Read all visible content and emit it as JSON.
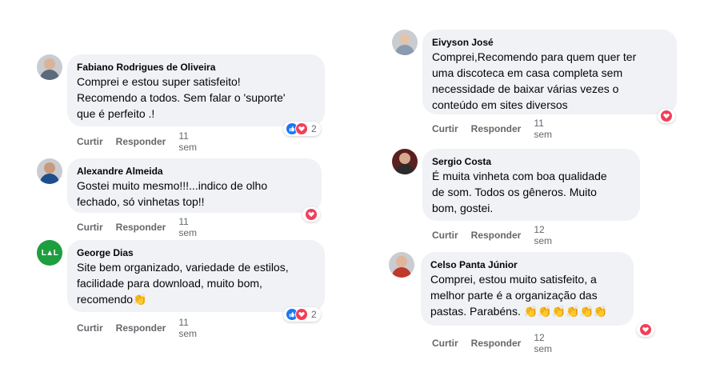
{
  "actions": {
    "like": "Curtir",
    "reply": "Responder"
  },
  "comments": [
    {
      "author": "Fabiano Rodrigues de Oliveira",
      "text": "Comprei e estou super satisfeito!\nRecomendo a todos. Sem falar o 'suporte'\nque é perfeito .!",
      "time": "11 sem",
      "reaction_count": "2"
    },
    {
      "author": "Alexandre Almeida",
      "text": "Gostei muito mesmo!!!...indico de olho\nfechado, só vinhetas top!!",
      "time": "11 sem"
    },
    {
      "author": "George Dias",
      "text": "Site bem organizado, variedade de estilos,\nfacilidade para download, muito bom,\nrecomendo",
      "time": "11 sem",
      "reaction_count": "2",
      "emoji": "👏"
    },
    {
      "author": "Eivyson José",
      "text": "Comprei,Recomendo para quem quer ter\numa discoteca em casa completa sem\nnecessidade de baixar várias vezes o\nconteúdo em sites diversos",
      "time": "11 sem"
    },
    {
      "author": "Sergio Costa",
      "text": "É muita vinheta com boa qualidade\nde som. Todos os gêneros. Muito\nbom, gostei.",
      "time": "12 sem"
    },
    {
      "author": "Celso Panta Júnior",
      "text": "Comprei, estou muito satisfeito, a\nmelhor parte é a organização das\npastas. Parabéns.",
      "time": "12 sem",
      "emoji": "👏👏👏👏👏👏"
    }
  ],
  "colors": {
    "bubble": "#f0f2f5",
    "like": "#1877f2",
    "love": "#f33e58",
    "muted": "#65676b"
  }
}
